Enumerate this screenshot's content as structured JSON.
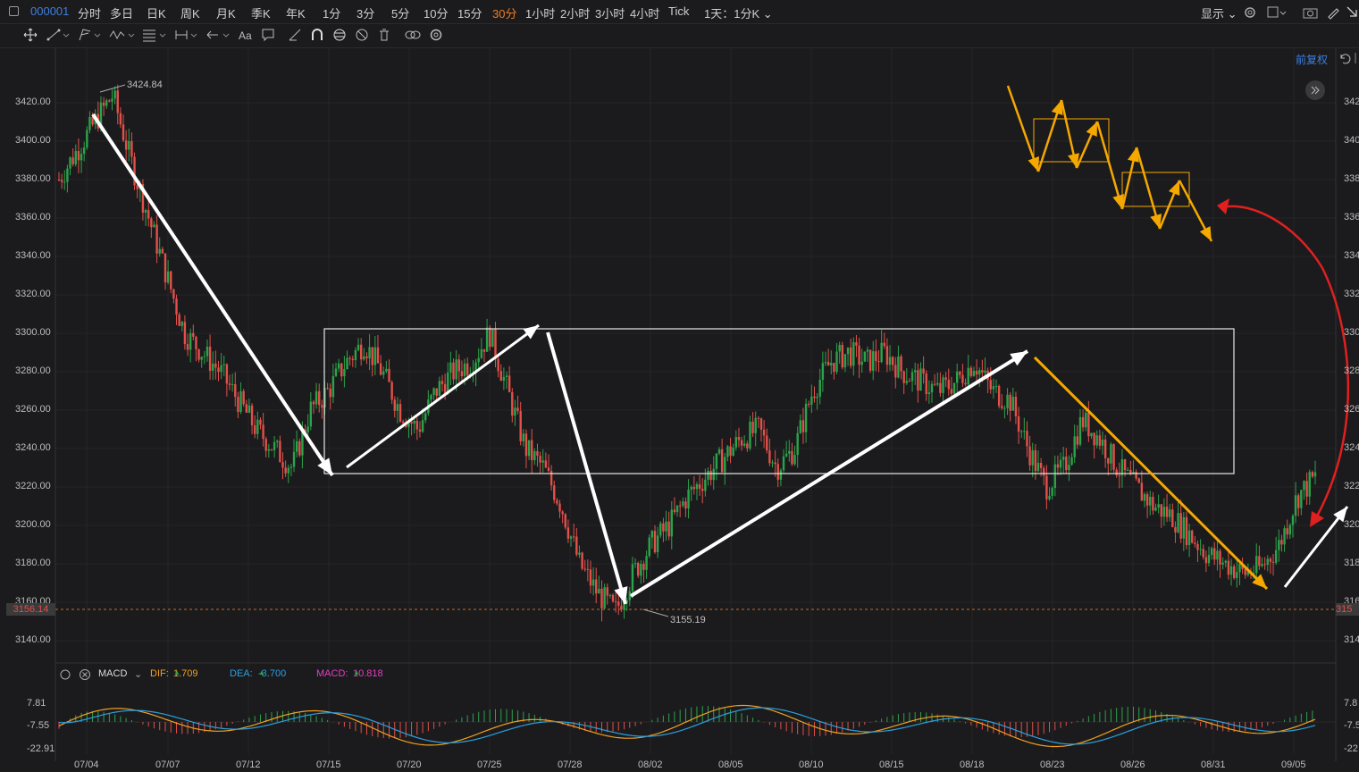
{
  "topbar": {
    "symbol": "000001",
    "timeframes": [
      "分时",
      "多日",
      "日K",
      "周K",
      "月K",
      "季K",
      "年K",
      "1分",
      "3分",
      "5分",
      "10分",
      "15分",
      "30分",
      "1小时",
      "2小时",
      "3小时",
      "4小时",
      "Tick"
    ],
    "active_timeframe": "30分",
    "period_select": "1天：1分K",
    "display_label": "显示"
  },
  "toolbar": {
    "icons": [
      "move-icon",
      "trendline-icon",
      "channel-icon",
      "wave-icon",
      "fib-icon",
      "measure-icon",
      "arrow-icon",
      "text-icon",
      "comment-icon",
      "ruler-icon",
      "magnet-icon",
      "lock-icon",
      "hide-icon",
      "delete-icon",
      "link-icon",
      "settings-icon"
    ],
    "text_tool_label": "Aa"
  },
  "chart": {
    "adjust_label": "前复权",
    "y_ticks": [
      "3420.00",
      "3400.00",
      "3380.00",
      "3360.00",
      "3340.00",
      "3320.00",
      "3300.00",
      "3280.00",
      "3260.00",
      "3240.00",
      "3220.00",
      "3200.00",
      "3180.00",
      "3160.00",
      "3140.00"
    ],
    "y_ticks_right": [
      "342",
      "340",
      "338",
      "336",
      "334",
      "332",
      "330",
      "328",
      "326",
      "324",
      "322",
      "320",
      "318",
      "316",
      "314"
    ],
    "x_ticks": [
      "07/04",
      "07/07",
      "07/12",
      "07/15",
      "07/20",
      "07/25",
      "07/28",
      "08/02",
      "08/05",
      "08/10",
      "08/15",
      "08/18",
      "08/23",
      "08/26",
      "08/31",
      "09/05"
    ],
    "high_label": "3424.84",
    "low_label": "3155.19",
    "current_price": "3156.14",
    "current_price_right": "315"
  },
  "chart_data": {
    "type": "candlestick",
    "y_range": [
      3130,
      3435
    ],
    "high": 3424.84,
    "low": 3155.19,
    "last": 3156.14,
    "approx_close_path": [
      3380,
      3395,
      3410,
      3424,
      3390,
      3360,
      3330,
      3300,
      3290,
      3280,
      3265,
      3250,
      3240,
      3230,
      3260,
      3270,
      3285,
      3295,
      3280,
      3260,
      3250,
      3270,
      3280,
      3285,
      3300,
      3270,
      3240,
      3230,
      3210,
      3180,
      3165,
      3155,
      3175,
      3190,
      3200,
      3215,
      3225,
      3235,
      3245,
      3250,
      3230,
      3240,
      3270,
      3285,
      3290,
      3285,
      3290,
      3280,
      3275,
      3270,
      3275,
      3285,
      3270,
      3265,
      3240,
      3220,
      3230,
      3255,
      3245,
      3230,
      3220,
      3210,
      3205,
      3195,
      3185,
      3180,
      3175,
      3178,
      3190,
      3215,
      3225
    ]
  },
  "macd": {
    "name": "MACD",
    "dif_label": "DIF:",
    "dif_value": "1.709",
    "dea_label": "DEA:",
    "dea_value": "-3.700",
    "macd_label": "MACD:",
    "macd_value": "10.818",
    "y_ticks": [
      "7.81",
      "-7.55",
      "-22.91"
    ],
    "y_ticks_right": [
      "7.8",
      "-7.5",
      "-22"
    ],
    "colors": {
      "dif": "#f0a020",
      "dea": "#2aa0e0",
      "macd_label": "#e040c0",
      "up": "#2ba34a",
      "down": "#e2504a"
    }
  }
}
